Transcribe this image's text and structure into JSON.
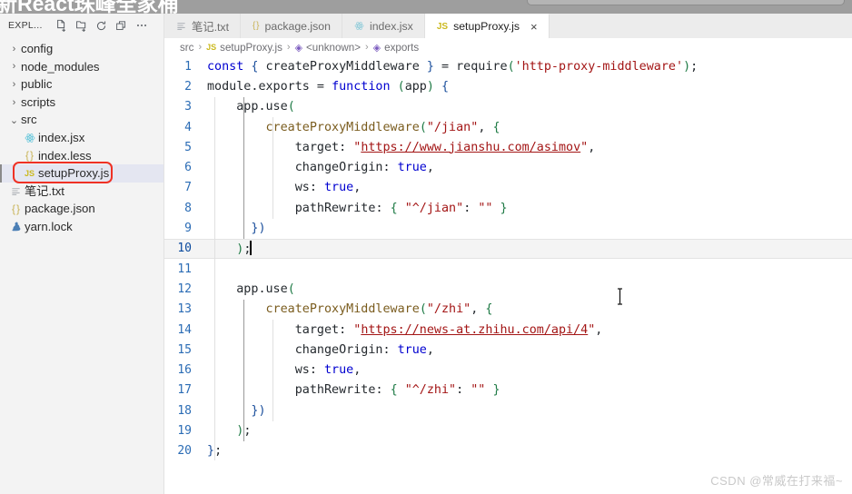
{
  "banner": {
    "title": "新React珠峰全家桶",
    "pill_text": ""
  },
  "sidebar": {
    "toolbar": {
      "label": "EXPL...",
      "icons": [
        {
          "name": "new-file-icon",
          "glyph": "new-file"
        },
        {
          "name": "new-folder-icon",
          "glyph": "new-folder"
        },
        {
          "name": "refresh-icon",
          "glyph": "refresh"
        },
        {
          "name": "collapse-all-icon",
          "glyph": "collapse-all"
        },
        {
          "name": "more-actions-icon",
          "glyph": "ellipsis"
        }
      ]
    },
    "tree": [
      {
        "label": "config",
        "type": "folder",
        "expanded": false,
        "depth": 1,
        "icon": "chevron-right-icon"
      },
      {
        "label": "node_modules",
        "type": "folder",
        "expanded": false,
        "depth": 1,
        "icon": "chevron-right-icon"
      },
      {
        "label": "public",
        "type": "folder",
        "expanded": false,
        "depth": 1,
        "icon": "chevron-right-icon"
      },
      {
        "label": "scripts",
        "type": "folder",
        "expanded": false,
        "depth": 1,
        "icon": "chevron-right-icon"
      },
      {
        "label": "src",
        "type": "folder",
        "expanded": true,
        "depth": 1,
        "icon": "chevron-down-icon"
      },
      {
        "label": "index.jsx",
        "type": "file",
        "depth": 2,
        "icon": "react-icon",
        "selected": false
      },
      {
        "label": "index.less",
        "type": "file",
        "depth": 2,
        "icon": "braces-icon",
        "selected": false
      },
      {
        "label": "setupProxy.js",
        "type": "file",
        "depth": 2,
        "icon": "js-icon",
        "selected": true
      },
      {
        "label": "笔记.txt",
        "type": "file",
        "depth": 1,
        "icon": "text-lines-icon",
        "selected": false
      },
      {
        "label": "package.json",
        "type": "file",
        "depth": 1,
        "icon": "braces-icon",
        "selected": false
      },
      {
        "label": "yarn.lock",
        "type": "file",
        "depth": 1,
        "icon": "yarn-icon",
        "selected": false
      }
    ],
    "annotation": {
      "shape": "rounded-rect",
      "color": "#ef3124",
      "target": "setupProxy.js"
    }
  },
  "tabs": [
    {
      "label": "笔记.txt",
      "icon": "text-lines-icon",
      "active": false,
      "closable": false
    },
    {
      "label": "package.json",
      "icon": "braces-icon",
      "active": false,
      "closable": false
    },
    {
      "label": "index.jsx",
      "icon": "react-icon",
      "active": false,
      "closable": false
    },
    {
      "label": "setupProxy.js",
      "icon": "js-icon",
      "active": true,
      "closable": true,
      "close_glyph": "×"
    }
  ],
  "breadcrumb": [
    {
      "label": "src",
      "icon": null
    },
    {
      "label": "setupProxy.js",
      "icon": "js-icon"
    },
    {
      "label": "<unknown>",
      "icon": "symbol-cube-icon"
    },
    {
      "label": "exports",
      "icon": "symbol-cube-icon"
    }
  ],
  "breadcrumb_separator": "›",
  "editor": {
    "active_line": 10,
    "lines": [
      {
        "n": "1",
        "tokens": [
          {
            "t": "const",
            "c": "kw"
          },
          {
            "t": " ",
            "c": "plain"
          },
          {
            "t": "{",
            "c": "punc"
          },
          {
            "t": " createProxyMiddleware ",
            "c": "plain"
          },
          {
            "t": "}",
            "c": "punc"
          },
          {
            "t": " = ",
            "c": "plain"
          },
          {
            "t": "require",
            "c": "plain"
          },
          {
            "t": "(",
            "c": "punc2"
          },
          {
            "t": "'http-proxy-middleware'",
            "c": "str"
          },
          {
            "t": ")",
            "c": "punc2"
          },
          {
            "t": ";",
            "c": "plain"
          }
        ]
      },
      {
        "n": "2",
        "tokens": [
          {
            "t": "module",
            "c": "plain"
          },
          {
            "t": ".",
            "c": "plain"
          },
          {
            "t": "exports",
            "c": "plain"
          },
          {
            "t": " = ",
            "c": "plain"
          },
          {
            "t": "function",
            "c": "kw"
          },
          {
            "t": " ",
            "c": "plain"
          },
          {
            "t": "(",
            "c": "punc2"
          },
          {
            "t": "app",
            "c": "plain"
          },
          {
            "t": ")",
            "c": "punc2"
          },
          {
            "t": " ",
            "c": "plain"
          },
          {
            "t": "{",
            "c": "punc"
          }
        ]
      },
      {
        "n": "3",
        "tokens": [
          {
            "t": "    app",
            "c": "plain"
          },
          {
            "t": ".",
            "c": "plain"
          },
          {
            "t": "use",
            "c": "plain"
          },
          {
            "t": "(",
            "c": "punc2"
          }
        ]
      },
      {
        "n": "4",
        "tokens": [
          {
            "t": "        ",
            "c": "plain"
          },
          {
            "t": "createProxyMiddleware",
            "c": "fn"
          },
          {
            "t": "(",
            "c": "punc2"
          },
          {
            "t": "\"/jian\"",
            "c": "str"
          },
          {
            "t": ", ",
            "c": "plain"
          },
          {
            "t": "{",
            "c": "punc2"
          }
        ]
      },
      {
        "n": "5",
        "tokens": [
          {
            "t": "            target",
            "c": "plain"
          },
          {
            "t": ": ",
            "c": "plain"
          },
          {
            "t": "\"",
            "c": "str"
          },
          {
            "t": "https://www.jianshu.com/asimov",
            "c": "url"
          },
          {
            "t": "\"",
            "c": "str"
          },
          {
            "t": ",",
            "c": "plain"
          }
        ]
      },
      {
        "n": "6",
        "tokens": [
          {
            "t": "            changeOrigin",
            "c": "plain"
          },
          {
            "t": ": ",
            "c": "plain"
          },
          {
            "t": "true",
            "c": "bool"
          },
          {
            "t": ",",
            "c": "plain"
          }
        ]
      },
      {
        "n": "7",
        "tokens": [
          {
            "t": "            ws",
            "c": "plain"
          },
          {
            "t": ": ",
            "c": "plain"
          },
          {
            "t": "true",
            "c": "bool"
          },
          {
            "t": ",",
            "c": "plain"
          }
        ]
      },
      {
        "n": "8",
        "tokens": [
          {
            "t": "            pathRewrite",
            "c": "plain"
          },
          {
            "t": ": ",
            "c": "plain"
          },
          {
            "t": "{",
            "c": "punc2"
          },
          {
            "t": " ",
            "c": "plain"
          },
          {
            "t": "\"^/jian\"",
            "c": "str"
          },
          {
            "t": ": ",
            "c": "plain"
          },
          {
            "t": "\"\"",
            "c": "str"
          },
          {
            "t": " ",
            "c": "plain"
          },
          {
            "t": "}",
            "c": "punc2"
          }
        ]
      },
      {
        "n": "9",
        "tokens": [
          {
            "t": "      ",
            "c": "plain"
          },
          {
            "t": "}",
            "c": "punc"
          },
          {
            "t": ")",
            "c": "punc"
          }
        ]
      },
      {
        "n": "10",
        "tokens": [
          {
            "t": "    ",
            "c": "plain"
          },
          {
            "t": ")",
            "c": "punc2"
          },
          {
            "t": ";",
            "c": "plain"
          }
        ]
      },
      {
        "n": "11",
        "tokens": []
      },
      {
        "n": "12",
        "tokens": [
          {
            "t": "    app",
            "c": "plain"
          },
          {
            "t": ".",
            "c": "plain"
          },
          {
            "t": "use",
            "c": "plain"
          },
          {
            "t": "(",
            "c": "punc2"
          }
        ]
      },
      {
        "n": "13",
        "tokens": [
          {
            "t": "        ",
            "c": "plain"
          },
          {
            "t": "createProxyMiddleware",
            "c": "fn"
          },
          {
            "t": "(",
            "c": "punc2"
          },
          {
            "t": "\"/zhi\"",
            "c": "str"
          },
          {
            "t": ", ",
            "c": "plain"
          },
          {
            "t": "{",
            "c": "punc2"
          }
        ]
      },
      {
        "n": "14",
        "tokens": [
          {
            "t": "            target",
            "c": "plain"
          },
          {
            "t": ": ",
            "c": "plain"
          },
          {
            "t": "\"",
            "c": "str"
          },
          {
            "t": "https://news-at.zhihu.com/api/4",
            "c": "url"
          },
          {
            "t": "\"",
            "c": "str"
          },
          {
            "t": ",",
            "c": "plain"
          }
        ]
      },
      {
        "n": "15",
        "tokens": [
          {
            "t": "            changeOrigin",
            "c": "plain"
          },
          {
            "t": ": ",
            "c": "plain"
          },
          {
            "t": "true",
            "c": "bool"
          },
          {
            "t": ",",
            "c": "plain"
          }
        ]
      },
      {
        "n": "16",
        "tokens": [
          {
            "t": "            ws",
            "c": "plain"
          },
          {
            "t": ": ",
            "c": "plain"
          },
          {
            "t": "true",
            "c": "bool"
          },
          {
            "t": ",",
            "c": "plain"
          }
        ]
      },
      {
        "n": "17",
        "tokens": [
          {
            "t": "            pathRewrite",
            "c": "plain"
          },
          {
            "t": ": ",
            "c": "plain"
          },
          {
            "t": "{",
            "c": "punc2"
          },
          {
            "t": " ",
            "c": "plain"
          },
          {
            "t": "\"^/zhi\"",
            "c": "str"
          },
          {
            "t": ": ",
            "c": "plain"
          },
          {
            "t": "\"\"",
            "c": "str"
          },
          {
            "t": " ",
            "c": "plain"
          },
          {
            "t": "}",
            "c": "punc2"
          }
        ]
      },
      {
        "n": "18",
        "tokens": [
          {
            "t": "      ",
            "c": "plain"
          },
          {
            "t": "}",
            "c": "punc"
          },
          {
            "t": ")",
            "c": "punc"
          }
        ]
      },
      {
        "n": "19",
        "tokens": [
          {
            "t": "    ",
            "c": "plain"
          },
          {
            "t": ")",
            "c": "punc2"
          },
          {
            "t": ";",
            "c": "plain"
          }
        ]
      },
      {
        "n": "20",
        "tokens": [
          {
            "t": "}",
            "c": "punc"
          },
          {
            "t": ";",
            "c": "plain"
          }
        ]
      }
    ]
  },
  "watermark": "CSDN @常威在打来福~",
  "colors": {
    "sidebar_bg": "#f3f3f3",
    "editor_bg": "#ffffff",
    "tabbar_bg": "#ececec",
    "selection_bg": "#e4e6f1",
    "annotation_red": "#ef3124",
    "linenumber": "#2b6cb5",
    "string": "#a31515",
    "keyword": "#0000d0",
    "function": "#7a5c1e",
    "watermark": "#c9c9c9"
  }
}
